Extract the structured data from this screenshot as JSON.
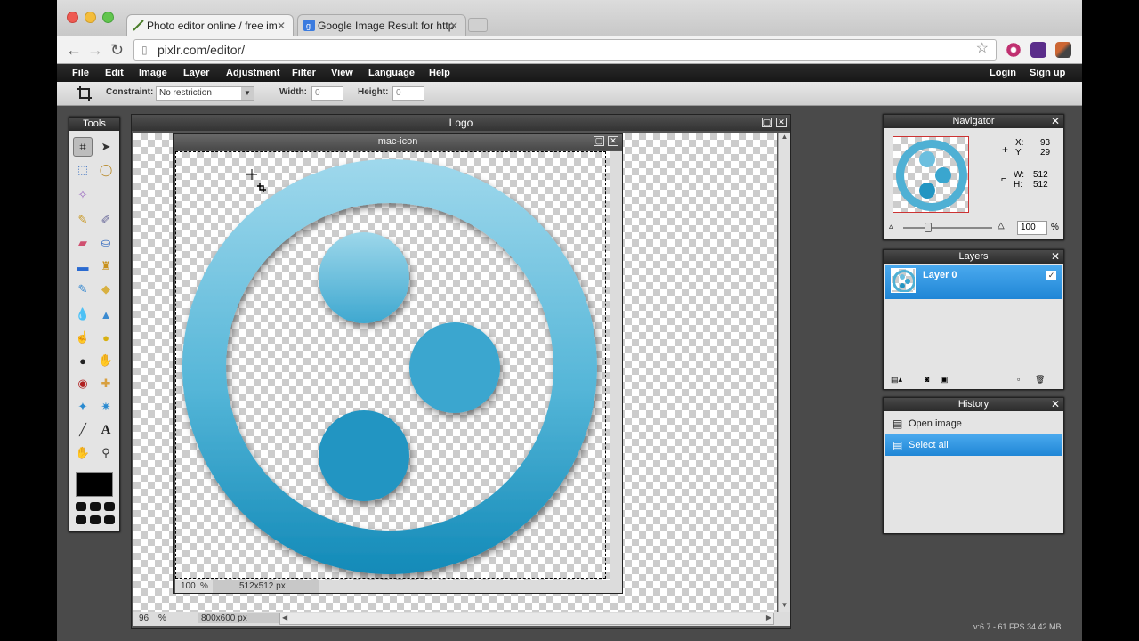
{
  "browser": {
    "tabs": [
      {
        "title": "Photo editor online / free im",
        "active": true
      },
      {
        "title": "Google Image Result for http",
        "active": false
      }
    ],
    "url": "pixlr.com/editor/"
  },
  "menu": {
    "items": [
      "File",
      "Edit",
      "Image",
      "Layer",
      "Adjustment",
      "Filter",
      "View",
      "Language",
      "Help"
    ],
    "login": "Login",
    "separator": "|",
    "signup": "Sign up"
  },
  "options": {
    "constraint_label": "Constraint:",
    "constraint_value": "No restriction",
    "width_label": "Width:",
    "width_value": "0",
    "height_label": "Height:",
    "height_value": "0"
  },
  "tools": {
    "title": "Tools",
    "icons": [
      "crop-icon",
      "move-icon",
      "marquee-icon",
      "lasso-icon",
      "wand-icon",
      "pencil-icon",
      "brush-icon",
      "eraser-icon",
      "bucket-icon",
      "gradient-icon",
      "stamp-icon",
      "color-replace-icon",
      "drawing-icon",
      "blur-icon",
      "sharpen-icon",
      "smudge-icon",
      "sponge-icon",
      "dodge-icon",
      "burn-icon",
      "redeye-icon",
      "spot-heal-icon",
      "bloat-icon",
      "pinch-icon",
      "picker-icon",
      "text-icon",
      "hand-icon",
      "zoom-icon"
    ]
  },
  "doc_logo": {
    "title": "Logo",
    "zoom": "96",
    "zoom_unit": "%",
    "size": "800x600 px"
  },
  "doc_mac": {
    "title": "mac-icon",
    "zoom": "100",
    "zoom_unit": "%",
    "size": "512x512 px"
  },
  "navigator": {
    "title": "Navigator",
    "x_label": "X:",
    "x": "93",
    "y_label": "Y:",
    "y": "29",
    "w_label": "W:",
    "w": "512",
    "h_label": "H:",
    "h": "512",
    "zoom": "100",
    "zoom_unit": "%"
  },
  "layers": {
    "title": "Layers",
    "items": [
      {
        "name": "Layer 0",
        "visible": true
      }
    ]
  },
  "history": {
    "title": "History",
    "items": [
      {
        "name": "Open image",
        "selected": false
      },
      {
        "name": "Select all",
        "selected": true
      }
    ]
  },
  "footer": {
    "version": "v:6.7 - 61 FPS 34.42 MB"
  },
  "colors": {
    "accent": "#2a8fd6",
    "icon_light": "#8fd0e8",
    "icon_dark": "#0f87b4"
  }
}
